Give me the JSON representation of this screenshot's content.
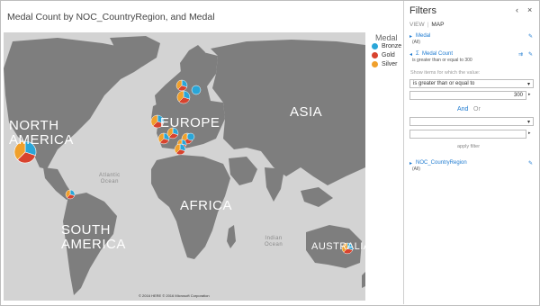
{
  "report": {
    "title": "Medal Count by NOC_CountryRegion, and Medal"
  },
  "map": {
    "labels": {
      "north_america": "NORTH\nAMERICA",
      "europe": "EUROPE",
      "asia": "ASIA",
      "africa": "AFRICA",
      "south_america": "SOUTH\nAMERICA",
      "australia": "AUSTRALIA",
      "atlantic": "Atlantic\nOcean",
      "indian": "Indian\nOcean"
    },
    "copyright": "© 2016 HERE   © 2016 Microsoft Corporation"
  },
  "legend": {
    "title": "Medal",
    "items": [
      {
        "label": "Bronze",
        "color": "#2aa6d8"
      },
      {
        "label": "Gold",
        "color": "#d8432e"
      },
      {
        "label": "Silver",
        "color": "#f0a02c"
      }
    ]
  },
  "filters": {
    "title": "Filters",
    "tabs": {
      "view": "VIEW",
      "map": "MAP"
    },
    "field_medal": {
      "name": "Medal",
      "value": "(All)"
    },
    "field_medal_count": {
      "name": "Medal Count",
      "summary": "is greater than or equal to 300"
    },
    "show_items_label": "Show items for which the value:",
    "condition1": "is greater than or equal to",
    "value1": "300",
    "and_label": "And",
    "or_label": "Or",
    "condition2": "",
    "value2": "",
    "apply_label": "apply filter",
    "field_noc": {
      "name": "NOC_CountryRegion",
      "value": "(All)"
    }
  }
}
